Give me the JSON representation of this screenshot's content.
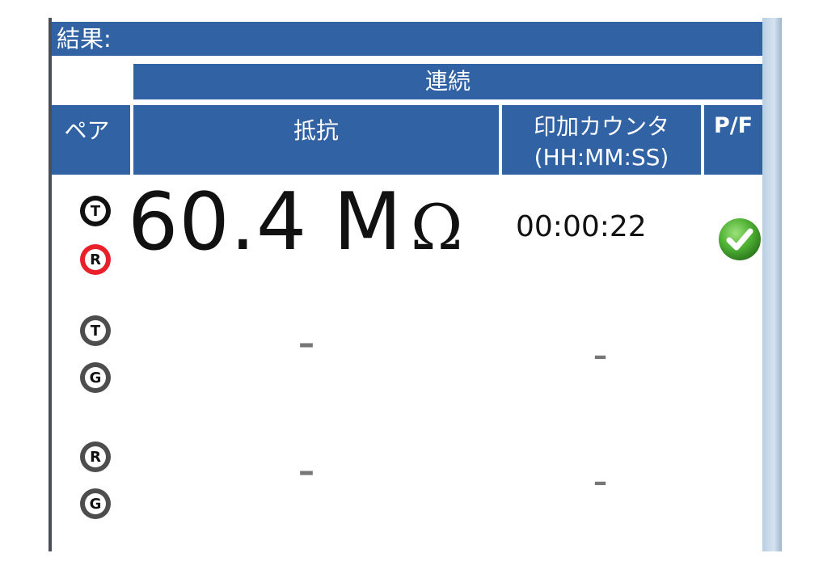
{
  "results": {
    "label": "結果:"
  },
  "group": {
    "label": "連続"
  },
  "columns": {
    "pair": "ペア",
    "resistance": "抵抗",
    "counter_line1": "印加カウンタ",
    "counter_line2": "(HH:MM:SS)",
    "pf": "P/F"
  },
  "rows": [
    {
      "pair_a": "T",
      "pair_b": "R",
      "resistance_value": "60.4 M",
      "resistance_unit": "Ω",
      "counter": "00:00:22",
      "status": "pass"
    },
    {
      "pair_a": "T",
      "pair_b": "G",
      "resistance_value": "–",
      "counter": "–"
    },
    {
      "pair_a": "R",
      "pair_b": "G",
      "resistance_value": "–",
      "counter": "–"
    }
  ],
  "colors": {
    "header_blue": "#3162a4",
    "badge_active_red": "#e8202a",
    "badge_dark": "#111111",
    "badge_inactive": "#4d4d4d",
    "pass_green": "#4caf32"
  },
  "icons": {
    "pass": "check-circle-icon"
  }
}
